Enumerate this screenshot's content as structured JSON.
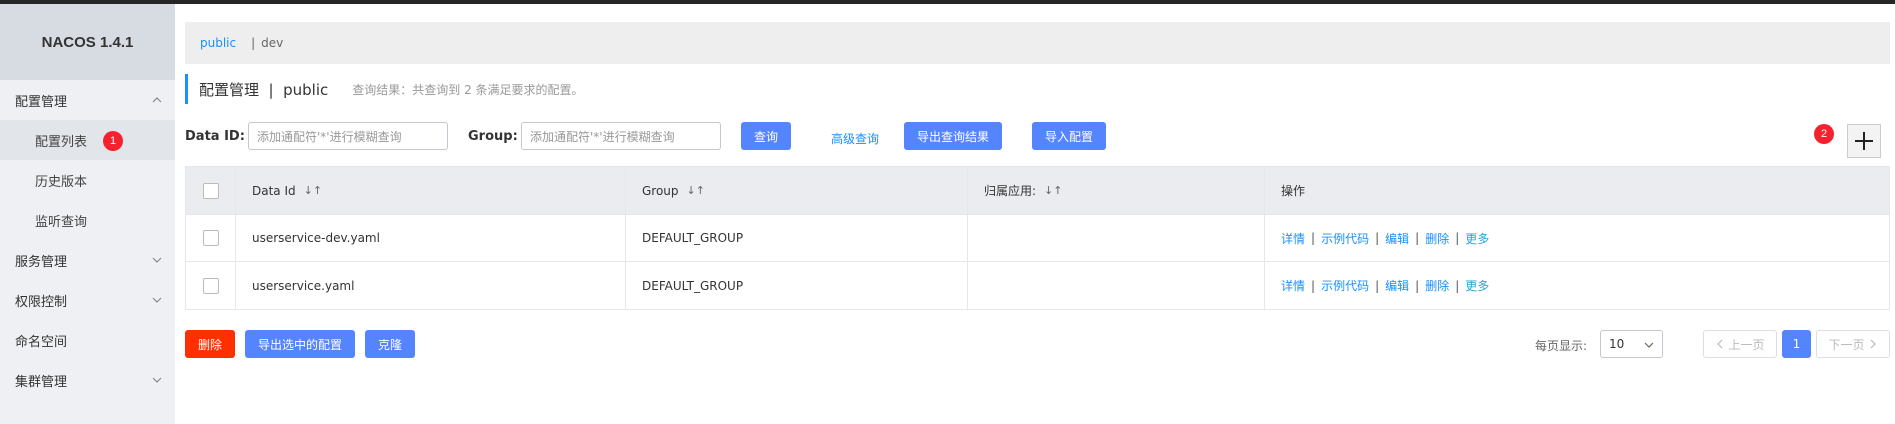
{
  "brand": "NACOS 1.4.1",
  "sidebar": {
    "items": [
      {
        "label": "配置管理"
      },
      {
        "label": "配置列表"
      },
      {
        "label": "历史版本"
      },
      {
        "label": "监听查询"
      },
      {
        "label": "服务管理"
      },
      {
        "label": "权限控制"
      },
      {
        "label": "命名空间"
      },
      {
        "label": "集群管理"
      }
    ]
  },
  "annotations": {
    "badge1": "1",
    "badge2": "2"
  },
  "namespace_bar": {
    "active": "public",
    "separator": "|",
    "other": "dev"
  },
  "page": {
    "title": "配置管理  |  public",
    "summary": "查询结果：共查询到 2 条满足要求的配置。"
  },
  "search": {
    "data_id_label": "Data ID:",
    "data_id_placeholder": "添加通配符'*'进行模糊查询",
    "group_label": "Group:",
    "group_placeholder": "添加通配符'*'进行模糊查询",
    "query_button": "查询",
    "advanced_link": "高级查询",
    "export_results_button": "导出查询结果",
    "import_button": "导入配置"
  },
  "table": {
    "headers": {
      "data_id": "Data Id",
      "group": "Group",
      "app": "归属应用:",
      "ops": "操作"
    },
    "sort_glyph": "↓↑",
    "rows": [
      {
        "data_id": "userservice-dev.yaml",
        "group": "DEFAULT_GROUP",
        "app": "",
        "ops": {
          "detail": "详情",
          "sample": "示例代码",
          "edit": "编辑",
          "delete": "删除",
          "more": "更多"
        }
      },
      {
        "data_id": "userservice.yaml",
        "group": "DEFAULT_GROUP",
        "app": "",
        "ops": {
          "detail": "详情",
          "sample": "示例代码",
          "edit": "编辑",
          "delete": "删除",
          "more": "更多"
        }
      }
    ],
    "op_separator": "|"
  },
  "footer": {
    "delete_button": "删除",
    "export_selected_button": "导出选中的配置",
    "clone_button": "克隆",
    "per_page_label": "每页显示:",
    "per_page_value": "10",
    "prev_button": "上一页",
    "current_page": "1",
    "next_button": "下一页"
  },
  "colors": {
    "primary": "#5584ff",
    "danger": "#ff3000",
    "link": "#1890ff",
    "badge": "#f5222d"
  }
}
